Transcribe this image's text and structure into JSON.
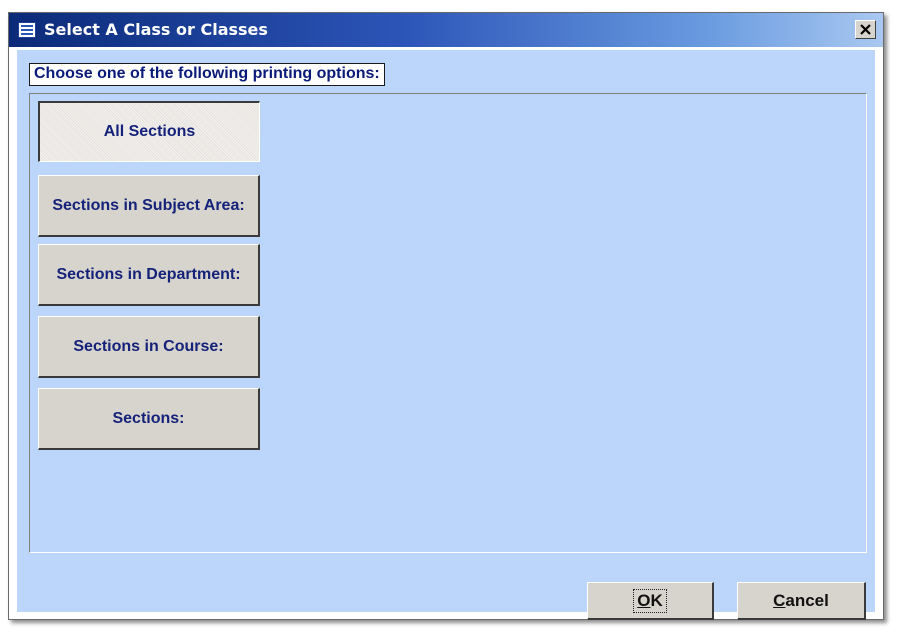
{
  "window": {
    "title": "Select A Class or Classes",
    "close_glyph": "✕",
    "icon": "form-icon"
  },
  "instruction": "Choose one of the following printing options:",
  "options": [
    {
      "label": "All Sections",
      "selected": true
    },
    {
      "label": "Sections in Subject Area:",
      "selected": false
    },
    {
      "label": "Sections in Department:",
      "selected": false
    },
    {
      "label": "Sections in Course:",
      "selected": false
    },
    {
      "label": "Sections:",
      "selected": false
    }
  ],
  "buttons": {
    "ok_label": "OK",
    "cancel_label": "Cancel"
  },
  "colors": {
    "client_background": "#bcd6fb",
    "button_face": "#d7d4cd",
    "option_text": "#15227a",
    "title_gradient_start": "#0b2a78"
  }
}
